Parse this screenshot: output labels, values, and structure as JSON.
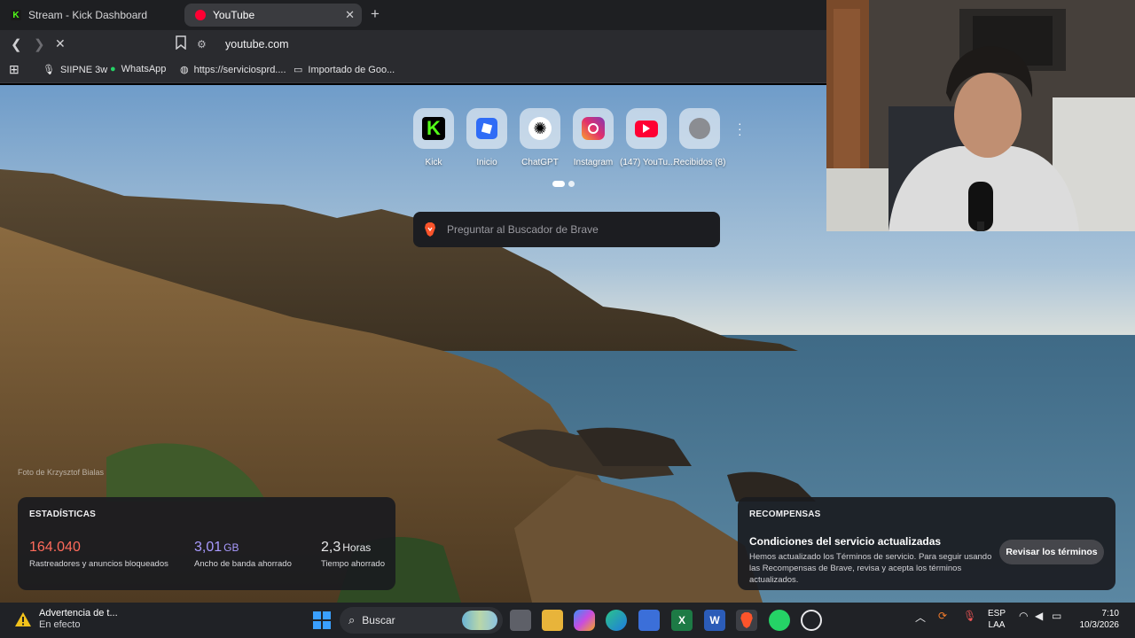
{
  "browser": {
    "tabs": [
      {
        "label": "Stream - Kick Dashboard",
        "active": false
      },
      {
        "label": "YouTube",
        "active": true
      }
    ],
    "new_tab_icon": "plus-icon",
    "url": "youtube.com",
    "bookmarks": [
      {
        "label": "SIIPNE 3w",
        "icon": "mic-icon"
      },
      {
        "label": "WhatsApp",
        "icon": "whatsapp-icon"
      },
      {
        "label": "https://serviciosprd....",
        "icon": "globe-icon"
      },
      {
        "label": "Importado de Goo...",
        "icon": "folder-icon"
      }
    ]
  },
  "newtab": {
    "top_sites": [
      {
        "label": "Kick",
        "icon": "kick-icon"
      },
      {
        "label": "Inicio",
        "icon": "roblox-icon"
      },
      {
        "label": "ChatGPT",
        "icon": "chatgpt-icon"
      },
      {
        "label": "Instagram",
        "icon": "instagram-icon"
      },
      {
        "label": "(147) YouTu...",
        "icon": "youtube-icon"
      },
      {
        "label": "Recibidos (8)",
        "icon": "globe-icon"
      }
    ],
    "search_placeholder": "Preguntar al Buscador de Brave",
    "photo_credit": "Foto de Krzysztof Bialas",
    "stats": {
      "title": "ESTADÍSTICAS",
      "items": [
        {
          "value": "164.040",
          "unit": "",
          "desc": "Rastreadores y anuncios bloqueados",
          "color": "#ff6b5b"
        },
        {
          "value": "3,01",
          "unit": "GB",
          "desc": "Ancho de banda ahorrado",
          "color": "#a99bff"
        },
        {
          "value": "2,3",
          "unit": "Horas",
          "desc": "Tiempo ahorrado",
          "color": "#ffffff"
        }
      ]
    },
    "rewards": {
      "title": "RECOMPENSAS",
      "heading": "Condiciones del servicio actualizadas",
      "text": "Hemos actualizado los Términos de servicio. Para seguir usando las Recompensas de Brave, revisa y acepta los términos actualizados.",
      "button": "Revisar los términos"
    }
  },
  "taskbar": {
    "warning_title": "Advertencia de t...",
    "warning_sub": "En efecto",
    "search_label": "Buscar",
    "lang_top": "ESP",
    "lang_bottom": "LAA",
    "time": "7:10",
    "date": "10/3/2026"
  }
}
